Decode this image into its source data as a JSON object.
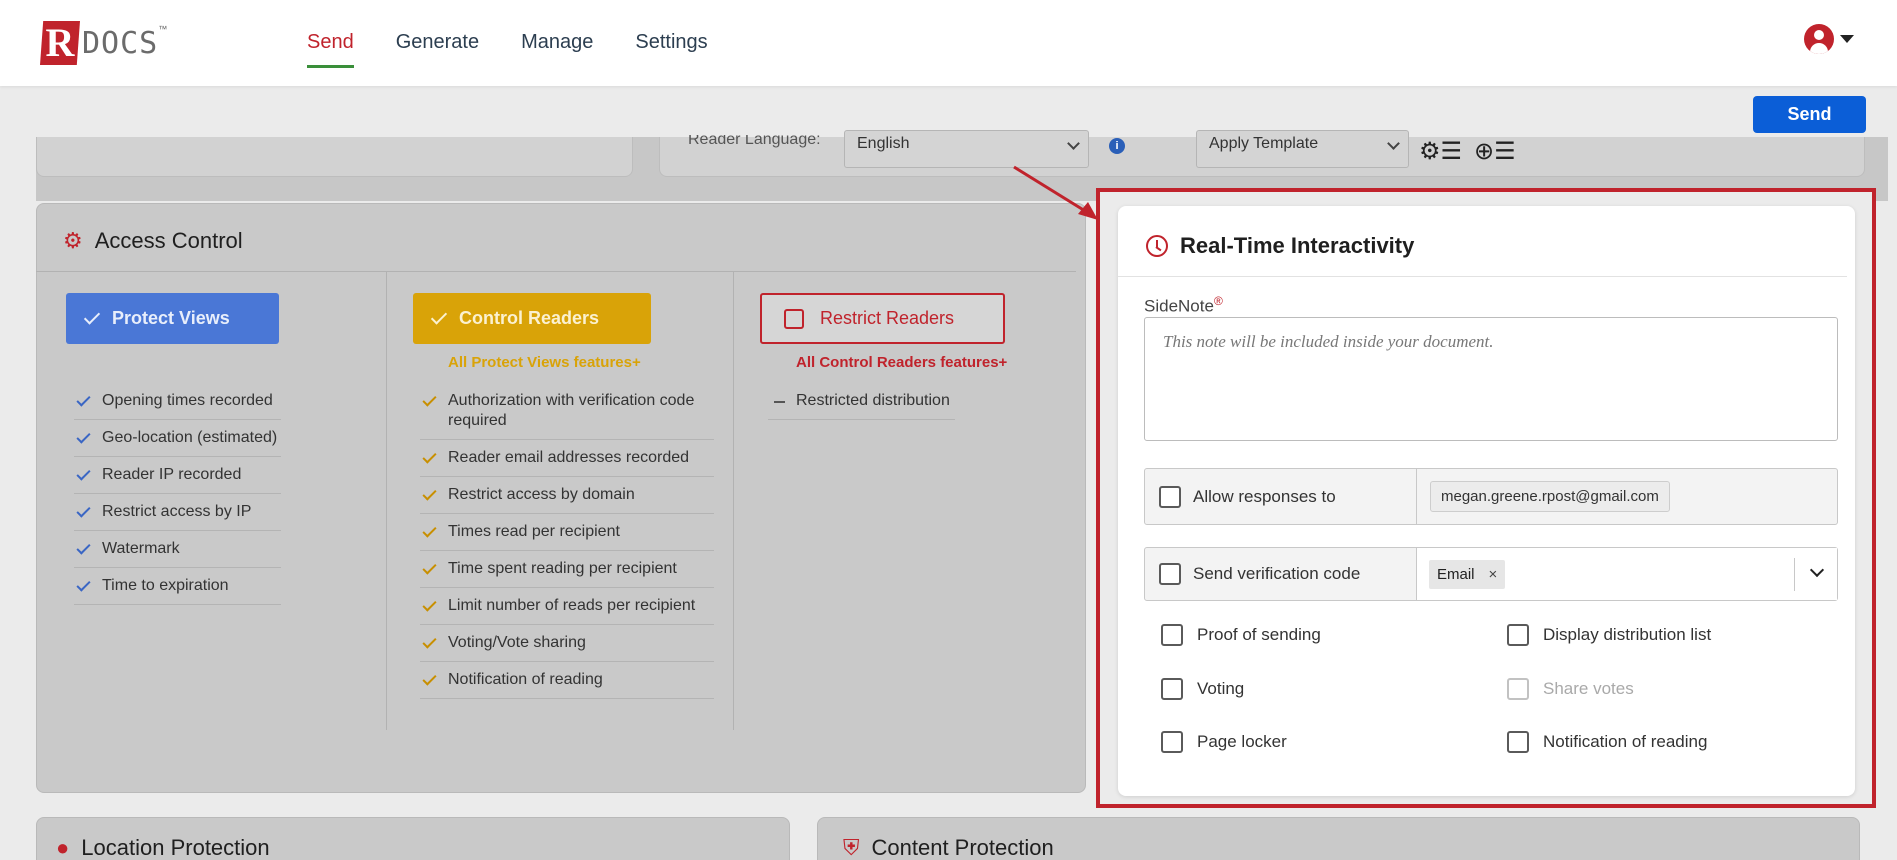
{
  "header": {
    "logo_letter": "R",
    "logo_text": "DOCS",
    "logo_tm": "™",
    "nav": [
      {
        "label": "Send",
        "active": true
      },
      {
        "label": "Generate",
        "active": false
      },
      {
        "label": "Manage",
        "active": false
      },
      {
        "label": "Settings",
        "active": false
      }
    ],
    "user_icon": "user-circle-icon"
  },
  "send_button": "Send",
  "top_strip": {
    "reader_language_label": "Reader Language:",
    "reader_language_value": "English",
    "template_value": "Apply Template",
    "template_icons": [
      "template-settings-icon",
      "template-add-icon"
    ]
  },
  "access_control": {
    "title": "Access Control",
    "tiers": [
      {
        "label": "Protect Views",
        "color": "#4a77d6",
        "features_plus": "",
        "features": [
          "Opening times recorded",
          "Geo-location (estimated)",
          "Reader IP recorded",
          "Restrict access by IP",
          "Watermark",
          "Time to expiration"
        ]
      },
      {
        "label": "Control Readers",
        "color": "#d9a308",
        "features_plus": "All Protect Views features+",
        "features": [
          "Authorization with verification code required",
          "Reader email addresses recorded",
          "Restrict access by domain",
          "Times read per recipient",
          "Time spent reading per recipient",
          "Limit number of reads per recipient",
          "Voting/Vote sharing",
          "Notification of reading"
        ]
      },
      {
        "label": "Restrict Readers",
        "color": "#c0232c",
        "features_plus": "All Control Readers features+",
        "features": [
          "Restricted distribution"
        ]
      }
    ]
  },
  "bottom_sections": {
    "location": "Location Protection",
    "content": "Content Protection"
  },
  "realtime": {
    "title": "Real-Time Interactivity",
    "sidenote_label": "SideNote",
    "sidenote_required_mark": "®",
    "sidenote_placeholder": "This note will be included inside your document.",
    "allow_responses_label": "Allow responses to",
    "allow_responses_email": "megan.greene.rpost@gmail.com",
    "verification_label": "Send verification code",
    "verification_tag": "Email",
    "verification_tag_remove": "×",
    "options": [
      {
        "label": "Proof of sending",
        "disabled": false
      },
      {
        "label": "Display distribution list",
        "disabled": false
      },
      {
        "label": "Voting",
        "disabled": false
      },
      {
        "label": "Share votes",
        "disabled": true
      },
      {
        "label": "Page locker",
        "disabled": false
      },
      {
        "label": "Notification of reading",
        "disabled": false
      }
    ]
  },
  "colors": {
    "brand_red": "#c0232c",
    "send_blue": "#0b5ed7",
    "nav_active_underline": "#3a8f3a"
  }
}
